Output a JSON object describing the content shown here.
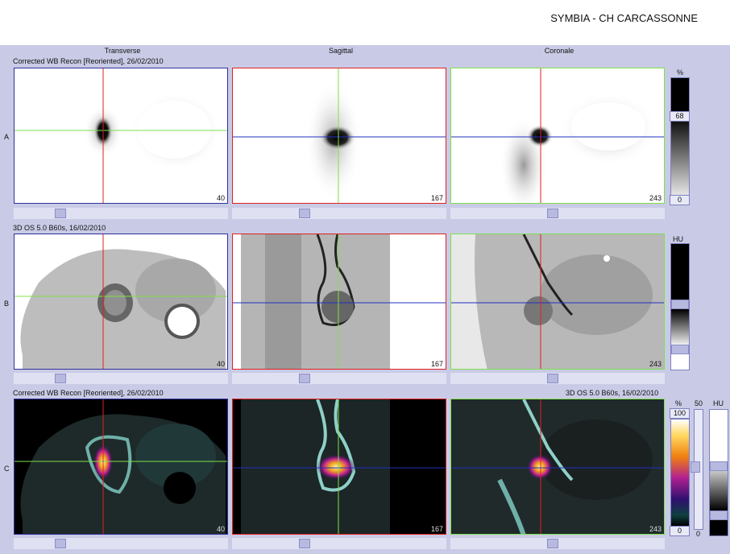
{
  "header": {
    "title": "SYMBIA - CH CARCASSONNE"
  },
  "columns": [
    "Transverse",
    "Sagittal",
    "Coronale"
  ],
  "rows": {
    "a": {
      "letter": "A",
      "info": "Corrected WB Recon [Reoriented], 26/02/2010"
    },
    "b": {
      "letter": "B",
      "info": "3D  OS  5.0  B60s, 16/02/2010"
    },
    "c": {
      "letter": "C",
      "info_left": "Corrected WB Recon [Reoriented], 26/02/2010",
      "info_right": "3D  OS  5.0  B60s, 16/02/2010"
    }
  },
  "slices": {
    "transverse": "40",
    "sagittal": "167",
    "coronale": "243"
  },
  "colorbars": {
    "a": {
      "unit": "%",
      "value": "68",
      "min": "0"
    },
    "b": {
      "unit": "HU"
    },
    "c": {
      "unit_pct": "%",
      "max": "100",
      "min": "0",
      "fusion": "50",
      "fusion_min": "0",
      "unit_hu": "HU"
    }
  },
  "colors": {
    "background": "#c9cbe6",
    "crosshair_red": "#e02020",
    "crosshair_green": "#7ee04a",
    "crosshair_blue": "#2030c0",
    "frame_blue": "#30309a"
  }
}
